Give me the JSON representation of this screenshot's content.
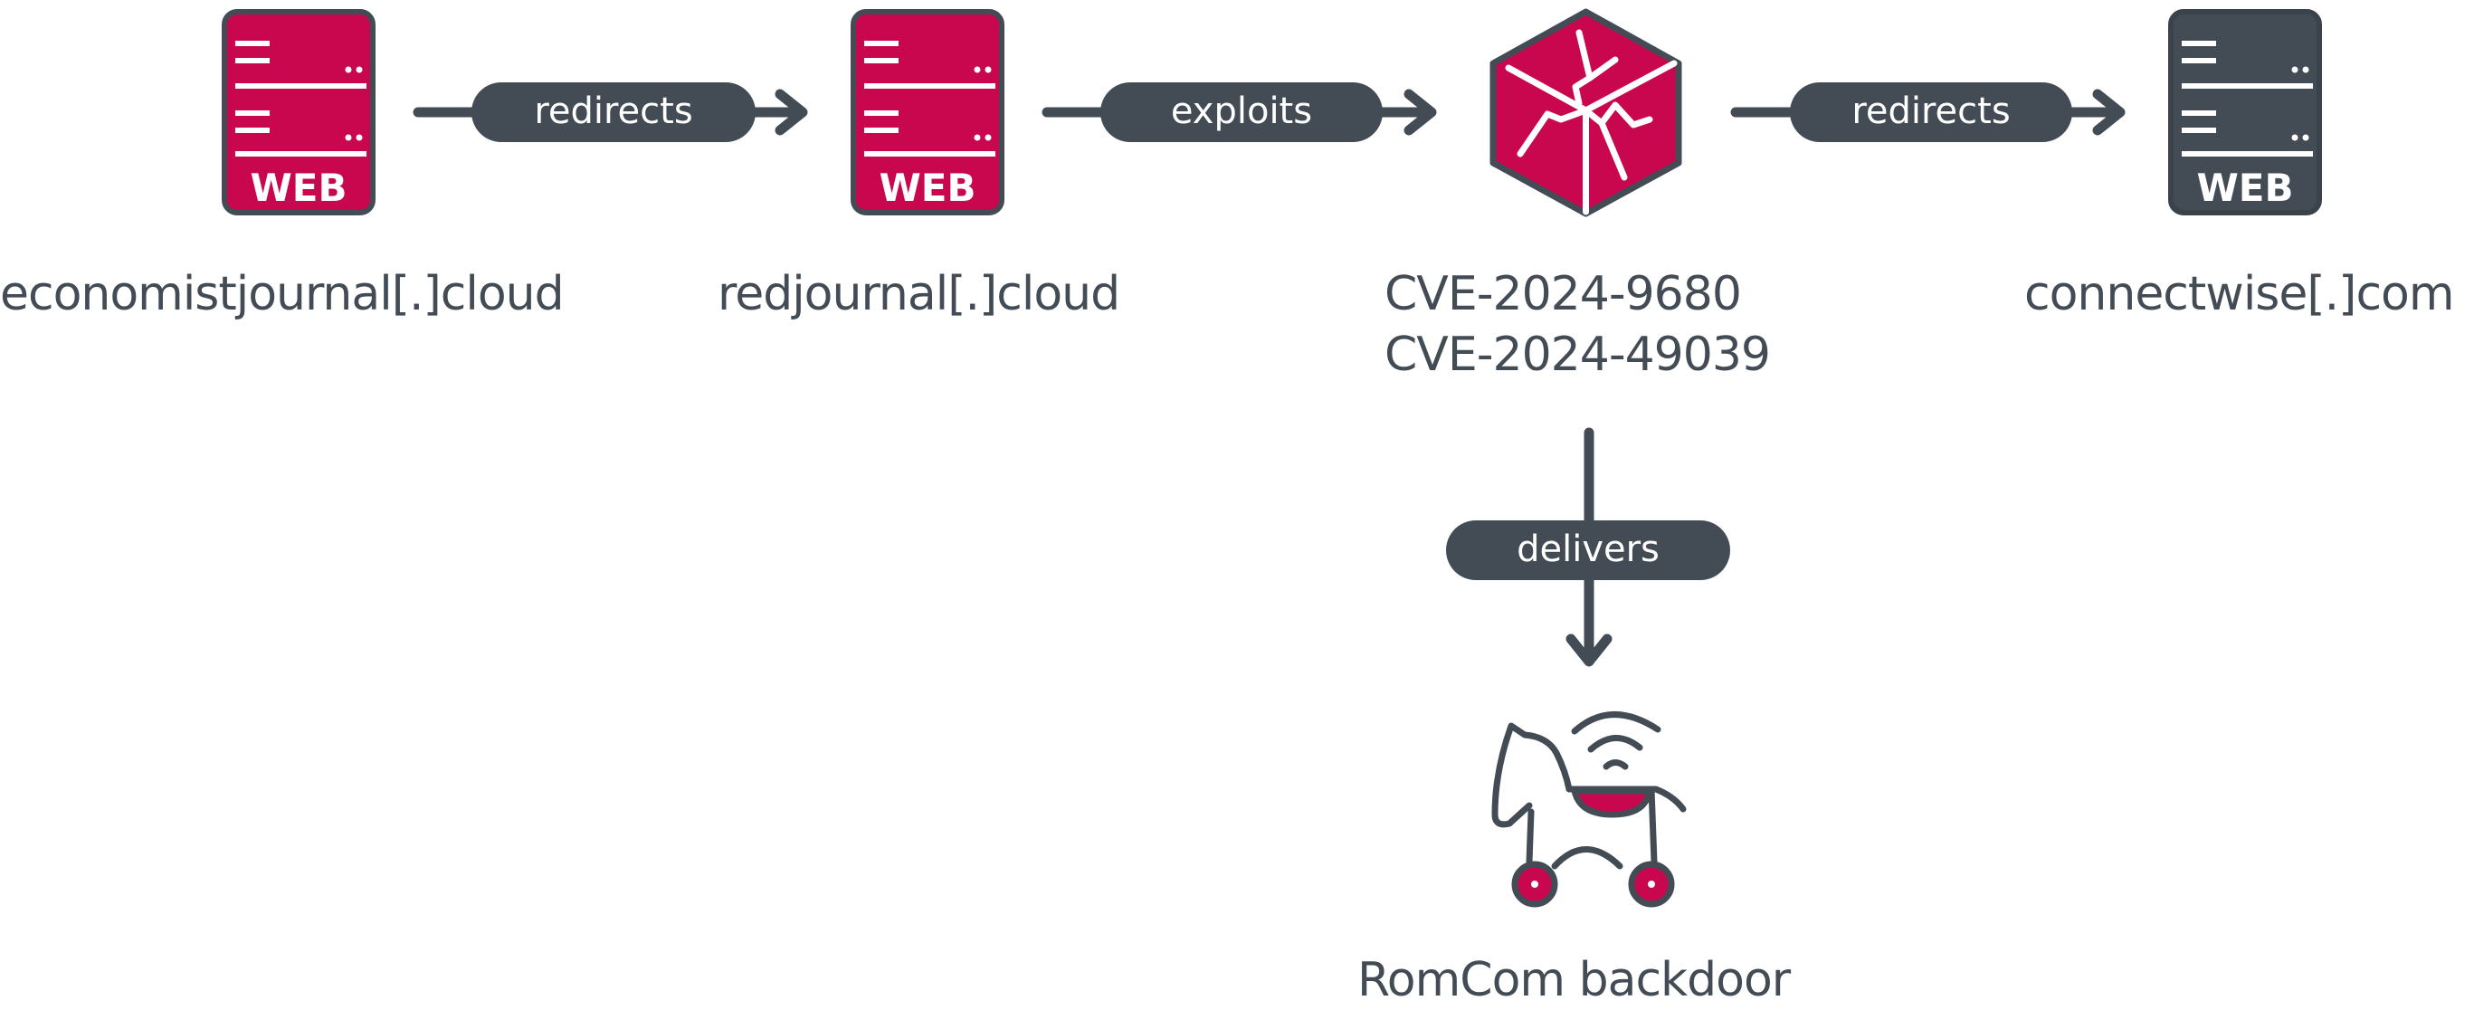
{
  "colors": {
    "accent": "#c8074e",
    "dark": "#434c55",
    "text": "#434c55",
    "background": "#ffffff"
  },
  "nodes": {
    "economist": {
      "label": "economistjournal[.]cloud",
      "icon": "web-server-icon",
      "icon_text": "WEB",
      "style": "accent"
    },
    "redjournal": {
      "label": "redjournal[.]cloud",
      "icon": "web-server-icon",
      "icon_text": "WEB",
      "style": "accent"
    },
    "cve": {
      "label_lines": [
        "CVE-2024-9680",
        "CVE-2024-49039"
      ],
      "icon": "broken-cube-icon",
      "style": "accent"
    },
    "connectwise": {
      "label": "connectwise[.]com",
      "icon": "web-server-icon",
      "icon_text": "WEB",
      "style": "dark"
    },
    "romcom": {
      "label": "RomCom backdoor",
      "icon": "trojan-horse-icon",
      "style": "accent"
    }
  },
  "edges": [
    {
      "from": "economist",
      "to": "redjournal",
      "label": "redirects",
      "direction": "right"
    },
    {
      "from": "redjournal",
      "to": "cve",
      "label": "exploits",
      "direction": "right"
    },
    {
      "from": "cve",
      "to": "connectwise",
      "label": "redirects",
      "direction": "right"
    },
    {
      "from": "cve",
      "to": "romcom",
      "label": "delivers",
      "direction": "down"
    }
  ]
}
